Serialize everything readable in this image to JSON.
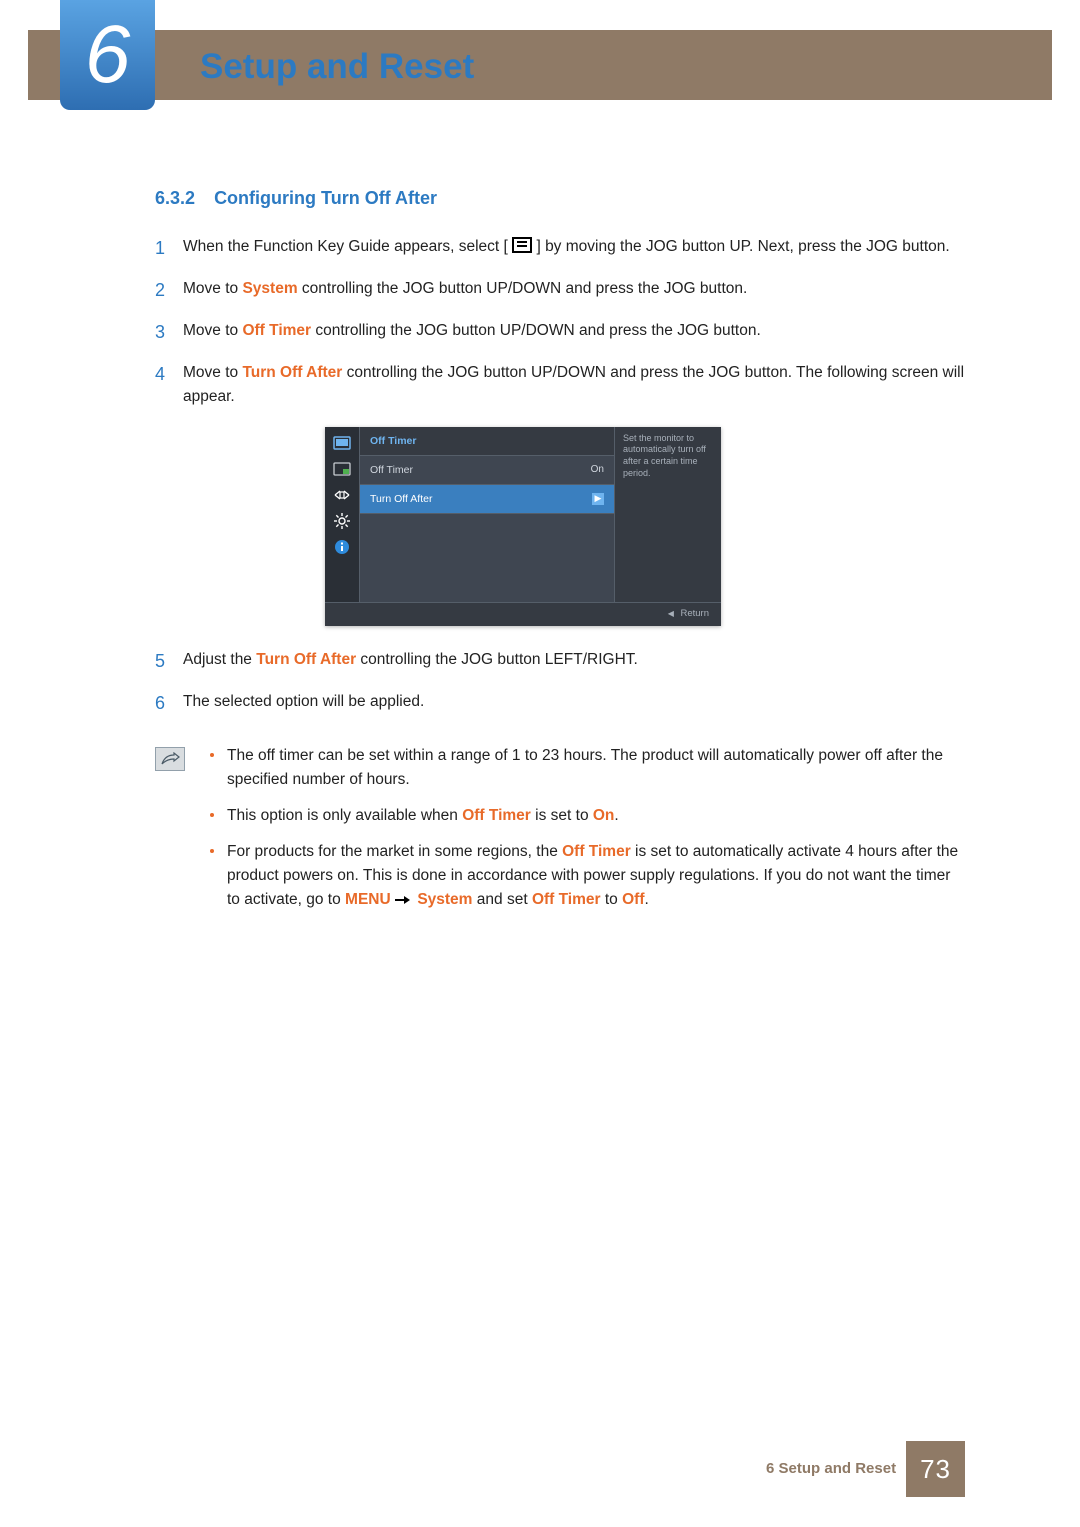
{
  "chapter": {
    "number": "6",
    "title": "Setup and Reset"
  },
  "section": {
    "number": "6.3.2",
    "title": "Configuring Turn Off After"
  },
  "steps": {
    "1a": "When the Function Key Guide appears, select [",
    "1b": "] by moving the JOG button UP. Next, press the JOG button.",
    "2a": "Move to ",
    "2k": "System",
    "2b": " controlling the JOG button UP/DOWN and press the JOG button.",
    "3a": "Move to ",
    "3k": "Off Timer",
    "3b": " controlling the JOG button UP/DOWN and press the JOG button.",
    "4a": "Move to ",
    "4k": "Turn Off After",
    "4b": " controlling the JOG button UP/DOWN and press the JOG button. The following screen will appear.",
    "5a": "Adjust the ",
    "5k": "Turn Off After",
    "5b": " controlling the JOG button LEFT/RIGHT.",
    "6": "The selected option will be applied."
  },
  "osd": {
    "title": "Off Timer",
    "row1": {
      "label": "Off Timer",
      "value": "On"
    },
    "row2": {
      "label": "Turn Off After"
    },
    "help": "Set the monitor to automatically turn off after a certain time period.",
    "return": "Return"
  },
  "notes": {
    "n1": "The off timer can be set within a range of 1 to 23 hours. The product will automatically power off after the specified number of hours.",
    "n2a": "This option is only available when ",
    "n2k1": "Off Timer",
    "n2b": " is set to ",
    "n2k2": "On",
    "n2c": ".",
    "n3a": "For products for the market in some regions, the ",
    "n3k1": "Off Timer",
    "n3b": " is set to automatically activate 4 hours after the product powers on. This is done in accordance with power supply regulations. If you do not want the timer to activate, go to ",
    "n3k2": "MENU",
    "n3k3": "System",
    "n3c": " and set ",
    "n3k4": "Off Timer",
    "n3d": " to ",
    "n3k5": "Off",
    "n3e": "."
  },
  "footer": {
    "chapter": "6 Setup and Reset",
    "page": "73"
  }
}
